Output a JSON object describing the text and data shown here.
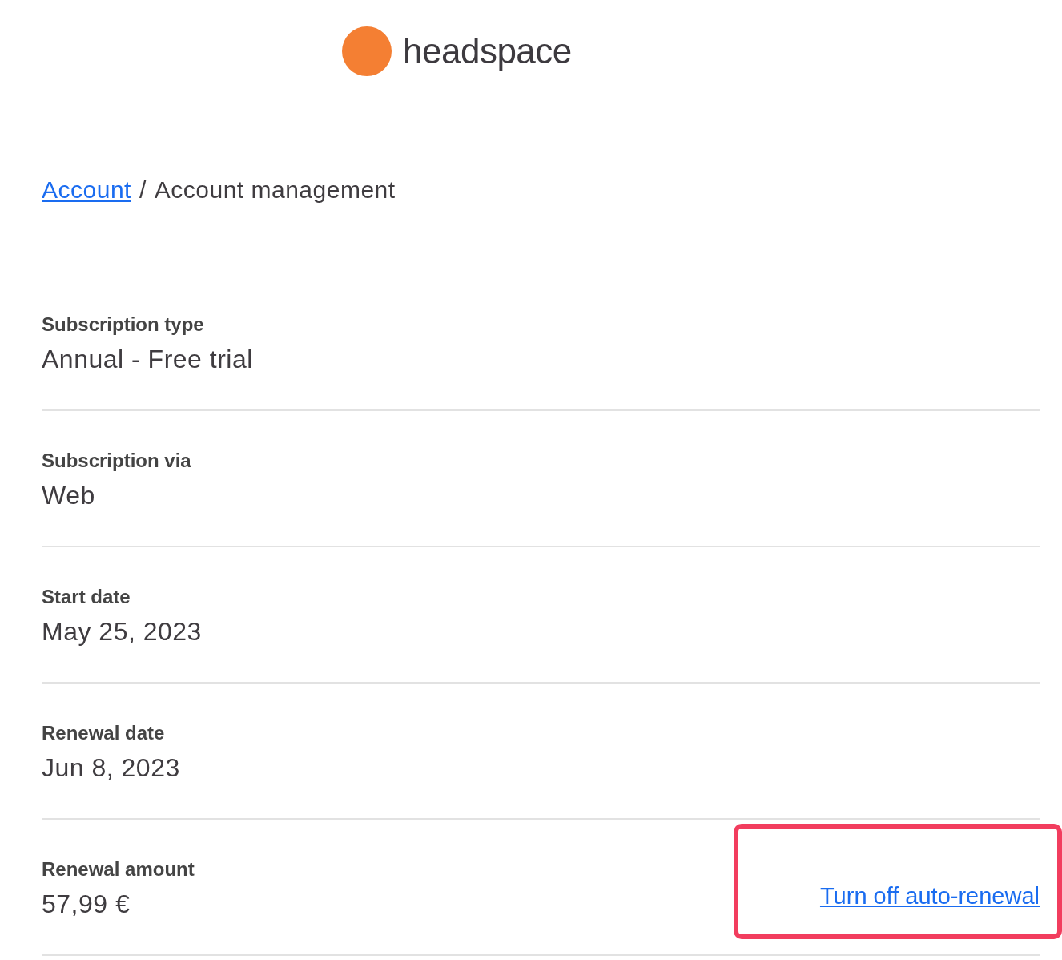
{
  "logo": {
    "text": "headspace"
  },
  "breadcrumb": {
    "link": "Account",
    "separator": "/",
    "current": "Account management"
  },
  "rows": [
    {
      "label": "Subscription type",
      "value": "Annual - Free trial"
    },
    {
      "label": "Subscription via",
      "value": "Web"
    },
    {
      "label": "Start date",
      "value": "May 25, 2023"
    },
    {
      "label": "Renewal date",
      "value": "Jun 8, 2023"
    },
    {
      "label": "Renewal amount",
      "value": "57,99 €",
      "action": {
        "text": "Turn off auto-renewal",
        "highlighted": true
      }
    }
  ]
}
